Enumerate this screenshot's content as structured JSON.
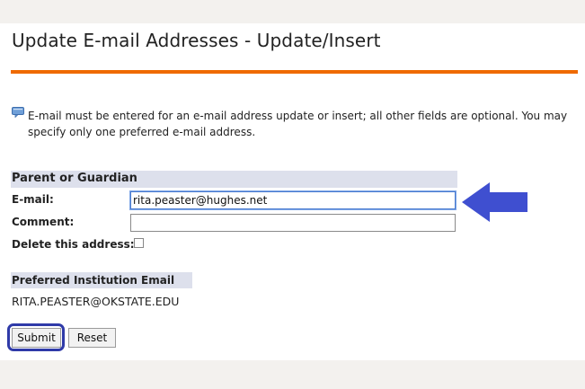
{
  "page": {
    "title": "Update E-mail Addresses - Update/Insert",
    "info_text": "E-mail must be entered for an e-mail address update or insert; all other fields are optional. You may specify only one preferred e-mail address.",
    "accent_color": "#ef6a00"
  },
  "section": {
    "header": "Parent or Guardian",
    "email_label": "E-mail:",
    "email_value": "rita.peaster@hughes.net",
    "comment_label": "Comment:",
    "comment_value": "",
    "delete_label": "Delete this address:",
    "delete_checked": false
  },
  "preferred": {
    "header": "Preferred Institution Email",
    "value": "RITA.PEASTER@OKSTATE.EDU"
  },
  "buttons": {
    "submit": "Submit",
    "reset": "Reset"
  },
  "annotations": {
    "arrow_color": "#3f4fd0",
    "highlight_color": "#2f3aa8",
    "icons": [
      "info-icon",
      "arrow-pointer-icon"
    ]
  }
}
